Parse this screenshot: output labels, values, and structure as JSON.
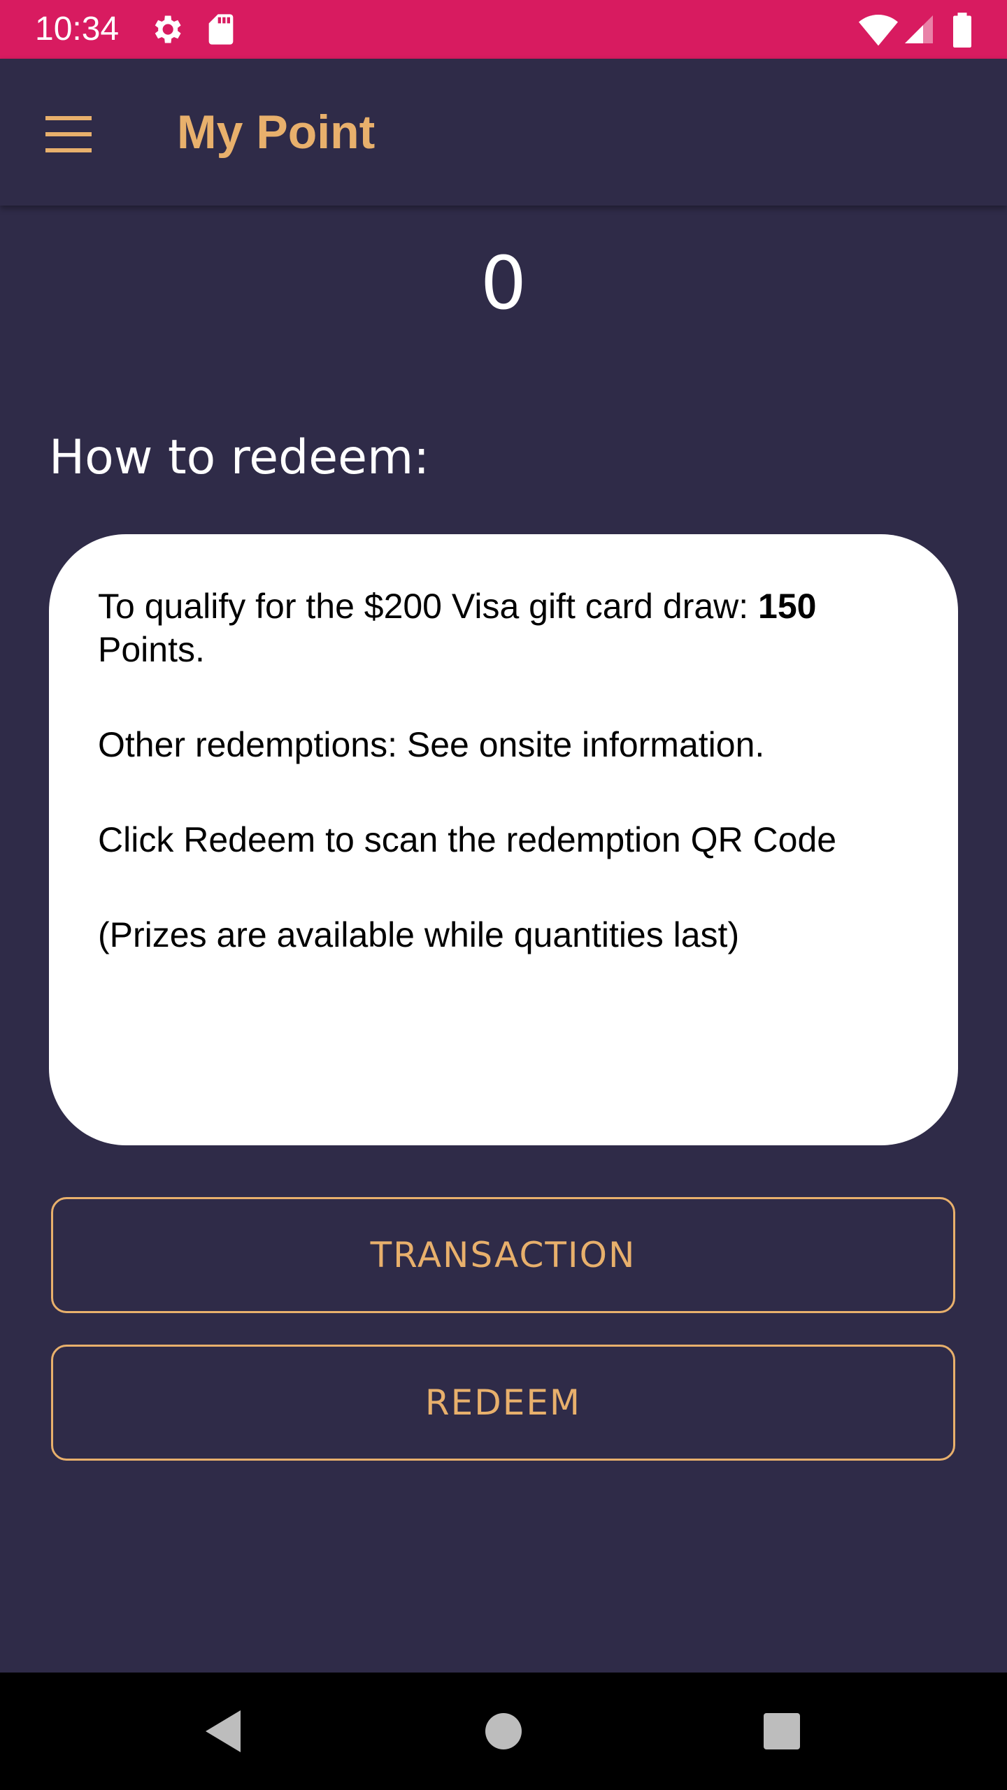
{
  "status_bar": {
    "time": "10:34",
    "background": "#d81b60",
    "icons_left": [
      "settings-icon",
      "sd-card-icon"
    ],
    "icons_right": [
      "wifi-icon",
      "signal-icon",
      "battery-icon"
    ]
  },
  "app_bar": {
    "title": "My Point",
    "menu_icon": "hamburger-menu-icon",
    "title_color": "#e8b06c"
  },
  "points": {
    "value": "0"
  },
  "redeem_section": {
    "heading": "How to redeem:",
    "card": {
      "line1_prefix": "To qualify for the $200 Visa gift card draw: ",
      "line1_bold": "150",
      "line1_suffix": " Points.",
      "line2": "Other redemptions: See onsite information.",
      "line3": "Click Redeem to scan the redemption QR Code",
      "line4": "(Prizes are available while quantities last)"
    }
  },
  "buttons": {
    "transaction_label": "TRANSACTION",
    "redeem_label": "REDEEM"
  },
  "nav_bar": {
    "icons": [
      "back-icon",
      "home-icon",
      "recents-icon"
    ]
  },
  "colors": {
    "background": "#2f2b48",
    "accent": "#e8b06c",
    "card": "#ffffff"
  }
}
